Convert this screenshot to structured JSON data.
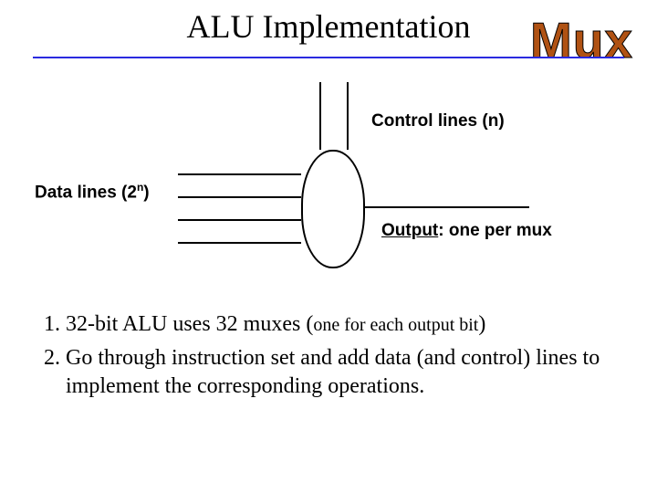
{
  "title": "ALU Implementation",
  "badge": "Mux",
  "labels": {
    "control": "Control lines (n)",
    "data_prefix": "Data lines (2",
    "data_sup": "n",
    "data_suffix": ")",
    "output_word": "Output",
    "output_rest": ": one per mux"
  },
  "list": {
    "item1_a": "32-bit ALU uses 32 muxes (",
    "item1_small": "one for each output bit",
    "item1_b": ")",
    "item2": "Go through instruction set and add data (and control) lines to implement the corresponding operations."
  }
}
